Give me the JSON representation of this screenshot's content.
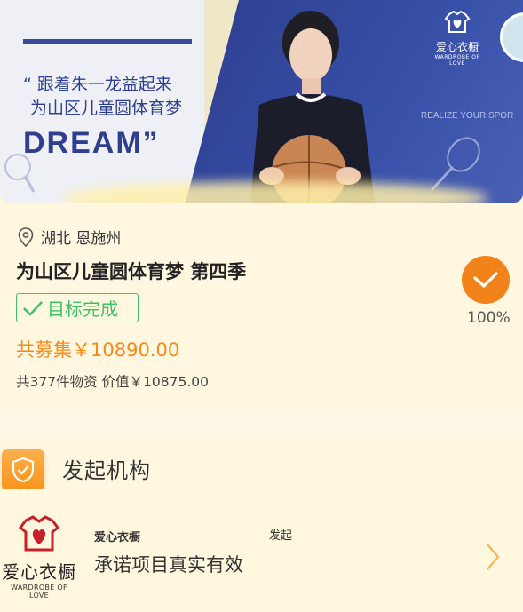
{
  "banner": {
    "quote_line1": "“ 跟着朱一龙益起来",
    "quote_line2": "为山区儿童圆体育梦",
    "dream": "DREAM”",
    "logo_name": "爱心衣橱",
    "logo_sub": "WARDROBE OF LOVE",
    "realize": "REALIZE YOUR SPOR"
  },
  "project": {
    "location": "湖北 恩施州",
    "title": "为山区儿童圆体育梦 第四季",
    "status_badge": "目标完成",
    "raised": "共募集￥10890.00",
    "supplies": "共377件物资 价值￥10875.00",
    "progress_percent": "100%",
    "colors": {
      "accent": "#f2821a",
      "success": "#3cc265"
    }
  },
  "organization": {
    "section_title": "发起机构",
    "logo_cn": "爱心衣橱",
    "logo_en": "WARDROBE OF LOVE",
    "name": "爱心衣橱",
    "launch_label": "发起",
    "promise": "承诺项目真实有效"
  }
}
